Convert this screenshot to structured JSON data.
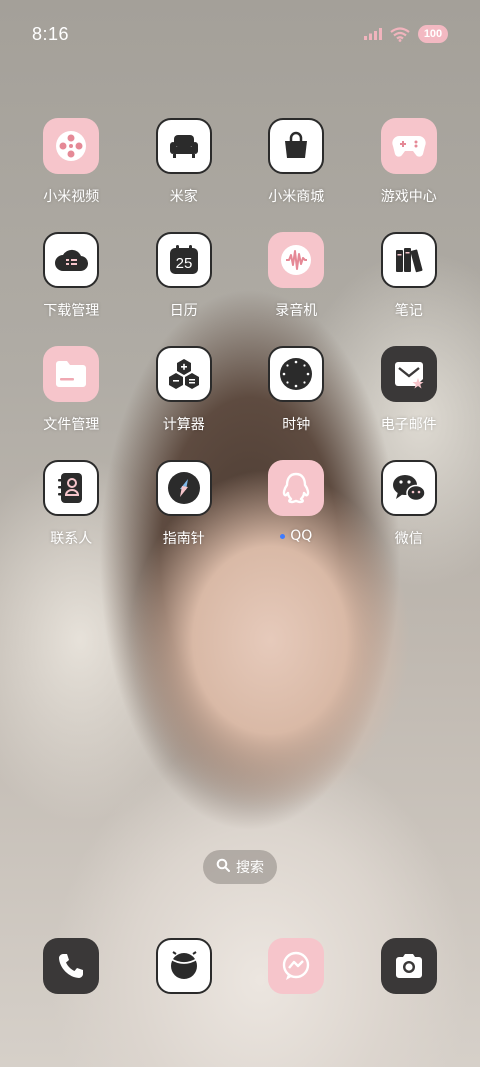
{
  "status_bar": {
    "time": "8:16",
    "battery": "100"
  },
  "apps": [
    {
      "label": "小米视频"
    },
    {
      "label": "米家"
    },
    {
      "label": "小米商城"
    },
    {
      "label": "游戏中心"
    },
    {
      "label": "下载管理"
    },
    {
      "label": "日历",
      "day": "25"
    },
    {
      "label": "录音机"
    },
    {
      "label": "笔记"
    },
    {
      "label": "文件管理"
    },
    {
      "label": "计算器"
    },
    {
      "label": "时钟"
    },
    {
      "label": "电子邮件"
    },
    {
      "label": "联系人"
    },
    {
      "label": "指南针"
    },
    {
      "label": "QQ"
    },
    {
      "label": "微信"
    }
  ],
  "search": {
    "label": "搜索"
  },
  "dock": [
    "phone-icon",
    "browser-icon",
    "messages-icon",
    "camera-icon"
  ],
  "colors": {
    "pink": "#f6c5cb",
    "dark": "#3a3838",
    "accent_pink": "#e58996"
  }
}
